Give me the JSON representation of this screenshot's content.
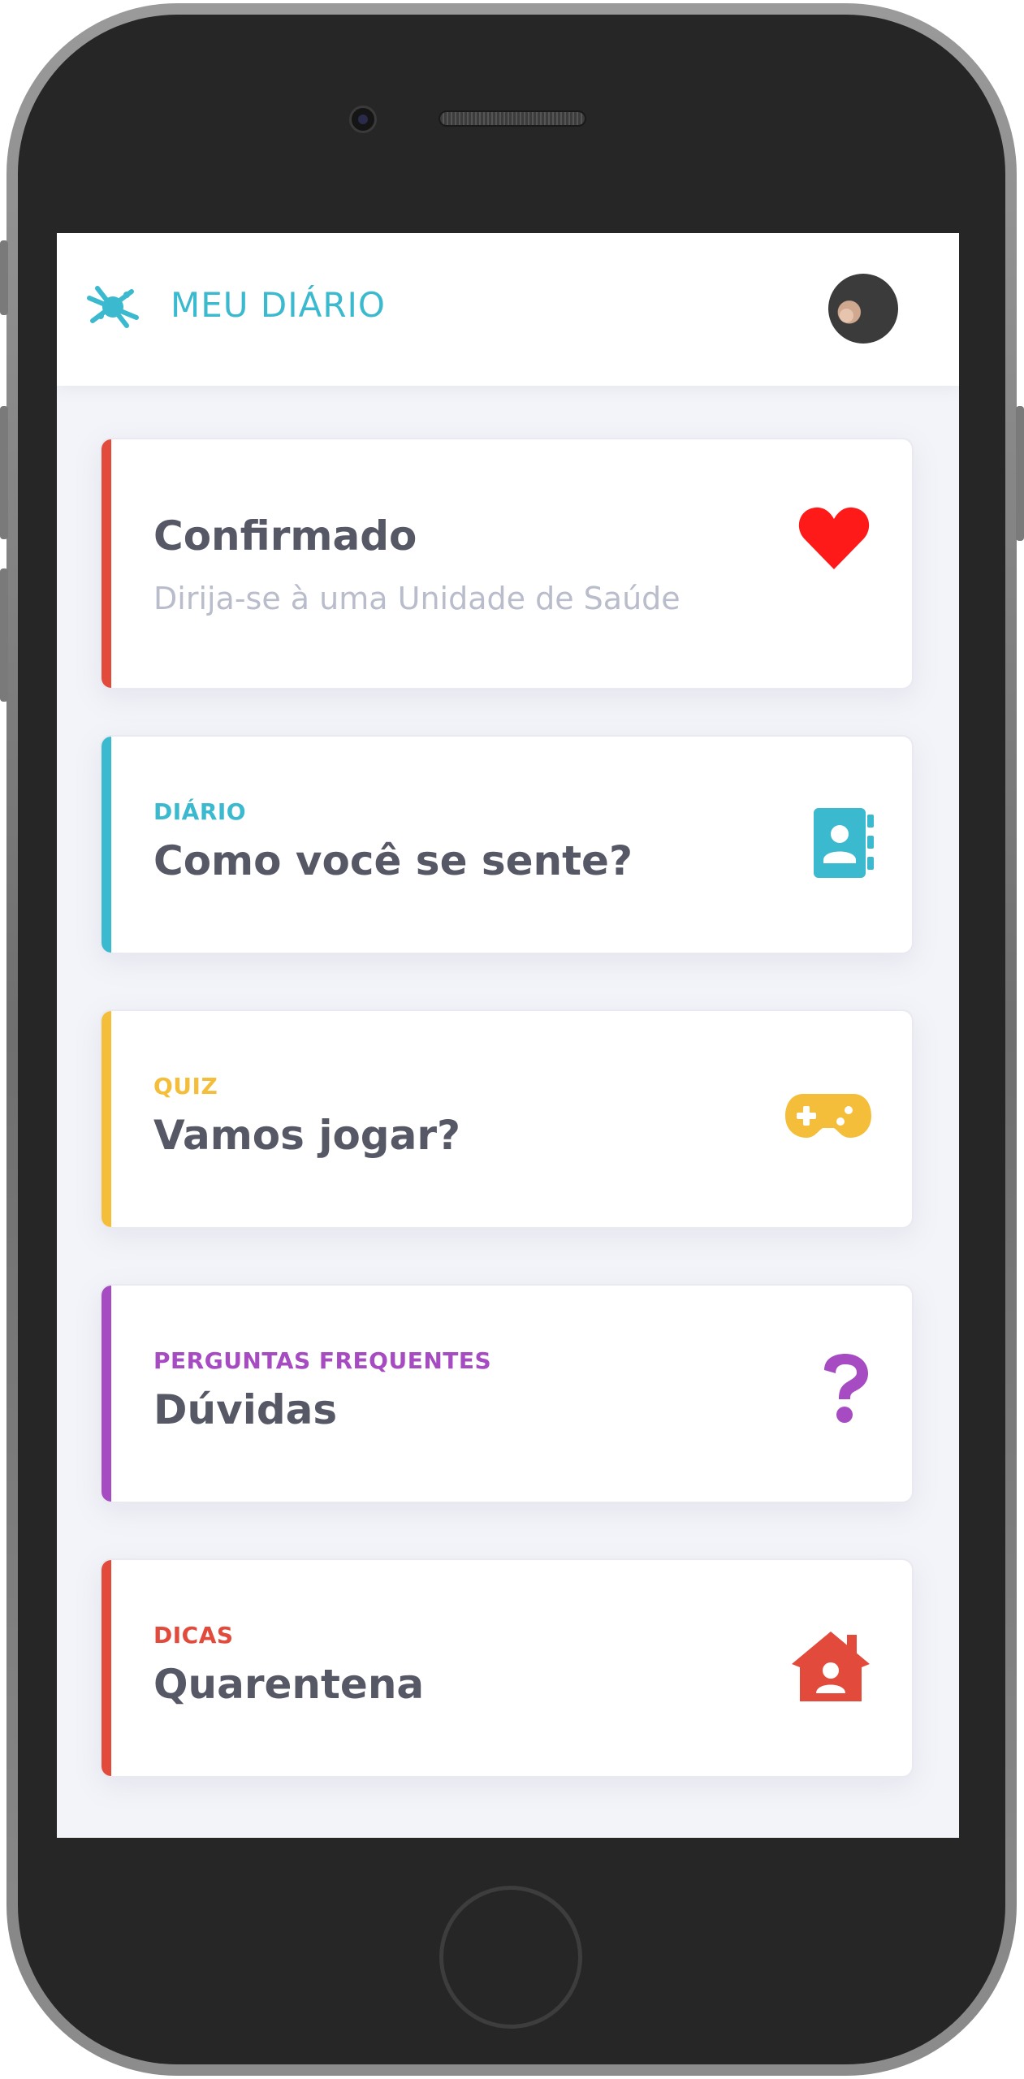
{
  "app": {
    "title": "MEU DIÁRIO"
  },
  "colors": {
    "brand": "#3bb9cf",
    "red": "#e24a3b",
    "teal": "#3bb9cf",
    "yellow": "#f5be3a",
    "purple": "#a64bc1",
    "heart": "#ff1a1a",
    "title_text": "#565866",
    "muted_text": "#b9bccb"
  },
  "cards": [
    {
      "title": "Confirmado",
      "subtitle": "Dirija-se à uma Unidade de Saúde",
      "icon": "heart-icon",
      "accent": "#e24a3b"
    },
    {
      "kicker": "DIÁRIO",
      "title": "Como você se sente?",
      "icon": "contact-book-icon",
      "accent": "#3bb9cf"
    },
    {
      "kicker": "QUIZ",
      "title": "Vamos jogar?",
      "icon": "gamepad-icon",
      "accent": "#f5be3a"
    },
    {
      "kicker": "PERGUNTAS FREQUENTES",
      "title": "Dúvidas",
      "icon": "question-mark-icon",
      "accent": "#a64bc1"
    },
    {
      "kicker": "DICAS",
      "title": "Quarentena",
      "icon": "house-user-icon",
      "accent": "#e24a3b"
    }
  ]
}
